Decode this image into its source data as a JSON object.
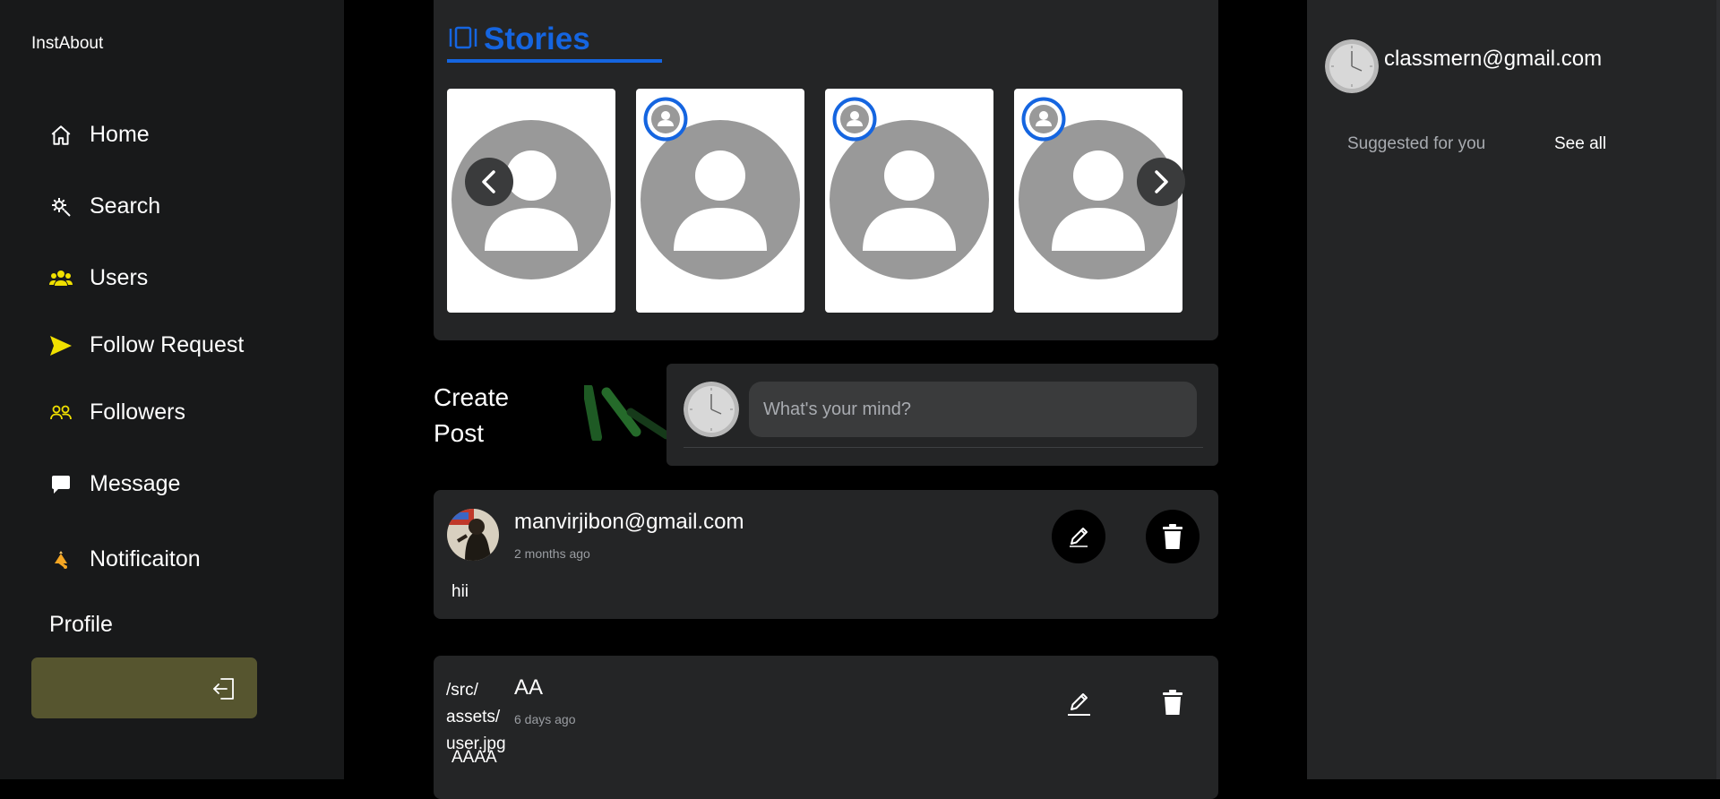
{
  "app": {
    "brand": "InstAbout"
  },
  "sidebar": {
    "items": [
      {
        "label": "Home",
        "icon": "home-icon"
      },
      {
        "label": "Search",
        "icon": "search-gear-icon"
      },
      {
        "label": "Users",
        "icon": "users-icon"
      },
      {
        "label": "Follow Request",
        "icon": "send-icon"
      },
      {
        "label": "Followers",
        "icon": "followers-icon"
      },
      {
        "label": "Message",
        "icon": "message-icon"
      },
      {
        "label": "Notificaiton",
        "icon": "notification-icon"
      }
    ],
    "profile_label": "Profile",
    "logout_icon": "logout-icon"
  },
  "stories": {
    "title": "Stories",
    "accent": "#1565e0"
  },
  "create_post": {
    "title_line1": "Create",
    "title_line2": "Post",
    "placeholder": "What's your mind?"
  },
  "posts": [
    {
      "author": "manvirjibon@gmail.com",
      "time": "2 months ago",
      "body": "hii"
    },
    {
      "author": "AA",
      "time": "6 days ago",
      "body": "AAAA",
      "avatar_alt": "/src/ assets/ user.jpg"
    }
  ],
  "right_panel": {
    "email": "classmern@gmail.com",
    "suggested_label": "Suggested for you",
    "see_all": "See all"
  },
  "colors": {
    "sidebar_bg": "#18191a",
    "card_bg": "#242526",
    "accent_yellow": "#f0e000",
    "logout_bg": "#56552f"
  }
}
